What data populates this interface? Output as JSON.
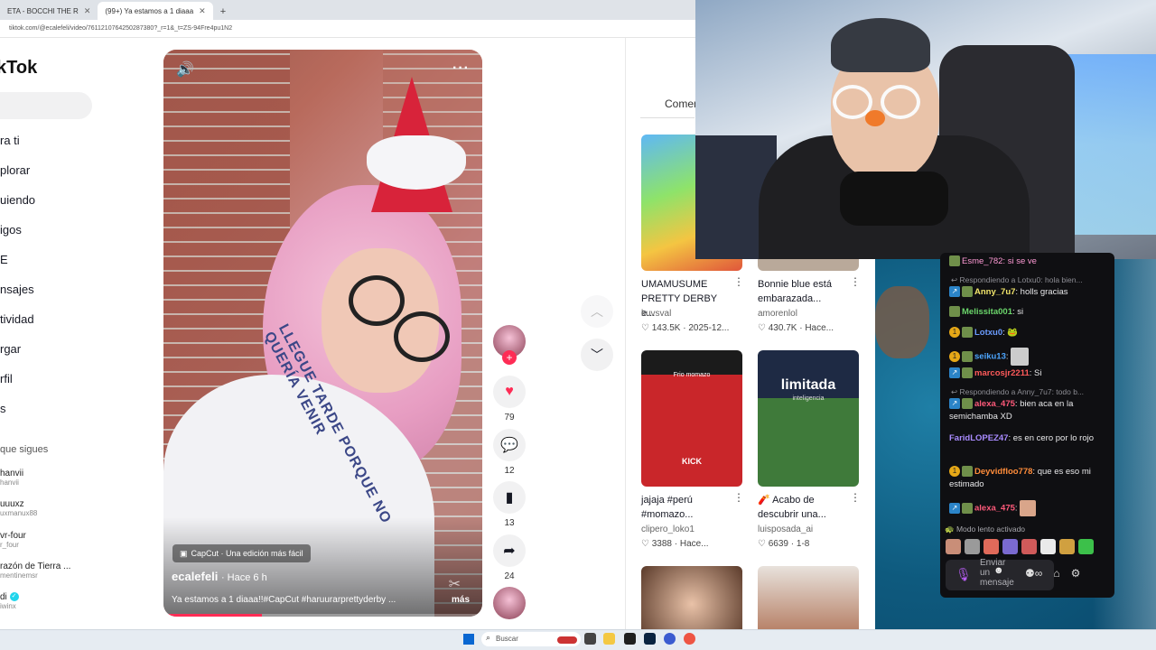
{
  "browser": {
    "tabs": [
      {
        "label": "ETA - BOCCHI THE R"
      },
      {
        "label": "(99+) Ya estamos a 1 diaaa"
      }
    ],
    "new_tab": "+",
    "address": "tiktok.com/@ecalefeli/video/7611210764250287380?_r=1&_t=ZS-94Fre4pu1N2"
  },
  "tiktok": {
    "logo": "kTok",
    "nav": [
      {
        "label": "ra ti"
      },
      {
        "label": "plorar"
      },
      {
        "label": "uiendo"
      },
      {
        "label": "igos"
      },
      {
        "label": "E"
      },
      {
        "label": "nsajes"
      },
      {
        "label": "tividad"
      },
      {
        "label": "rgar"
      },
      {
        "label": "rfil"
      },
      {
        "label": "s"
      }
    ],
    "following_header": "que sigues",
    "following": [
      {
        "name": "hanvii",
        "handle": "hanvii"
      },
      {
        "name": "uuuxz",
        "handle": "uxmanux88"
      },
      {
        "name": "vr-four",
        "handle": "r_four"
      },
      {
        "name": "razón de Tierra ...",
        "handle": "mentinemsr"
      },
      {
        "name": "di",
        "handle": "iwinx",
        "verified": true
      }
    ],
    "video": {
      "capcut_label": "CapCut · Una edición más fácil",
      "author": "ecalefeli",
      "time": "· Hace 6 h",
      "caption": "Ya estamos a 1 diaaa!!#CapCut #haruurarprettyderby ...",
      "more": "más",
      "shirt_text": "LLEGUE TARDE PORQUE NO QUERÍA VENIR",
      "progress": 0.31
    },
    "actions": {
      "likes": "79",
      "comments": "12",
      "saves": "13",
      "shares": "24"
    },
    "comments_tab": "Comen",
    "recommended": [
      {
        "title": "UMAMUSUME PRETTY DERBY e...",
        "author": "kuvsval",
        "stats": "♡ 143.5K · 2025-12..."
      },
      {
        "title": "Bonnie blue está embarazada...",
        "author": "amorenlol",
        "stats": "♡ 430.7K · Hace..."
      },
      {
        "title": "jajaja #perú #momazo...",
        "author": "clipero_loko1",
        "stats": "♡ 3388 · Hace...",
        "thumb_text": "Frio momazo",
        "thumb_tag": "KICK"
      },
      {
        "title": "🧨 Acabo de descubrir una...",
        "author": "luisposada_ai",
        "stats": "♡ 6639 · 1-8",
        "thumb_text": "limitada",
        "thumb_sub": "inteligencia"
      }
    ]
  },
  "chat": {
    "top_user": "Esme_782: si se ve",
    "messages": [
      {
        "type": "reply",
        "text": "↩ Respondiendo a Lotxu0: hola bien..."
      },
      {
        "type": "msg",
        "user": "Anny_7u7",
        "color": "#f3e66b",
        "text": ": holls gracias"
      },
      {
        "type": "msg",
        "user": "Melissita001",
        "color": "#6bd66b",
        "text": ": si"
      },
      {
        "type": "msg",
        "user": "Lotxu0",
        "color": "#6b9cff",
        "text": ":"
      },
      {
        "type": "msg",
        "user": "seiku13",
        "color": "#4da6ff",
        "text": ":"
      },
      {
        "type": "msg",
        "user": "marcosjr2211",
        "color": "#ff5a5a",
        "text": ": Si"
      },
      {
        "type": "reply",
        "text": "↩ Respondiendo a Anny_7u7: todo b..."
      },
      {
        "type": "msg",
        "user": "alexa_475",
        "color": "#ff5a7a",
        "text": ": bien aca en la semichamba XD"
      },
      {
        "type": "msg",
        "user": "FaridLOPEZ47",
        "color": "#a98bff",
        "text": ": es en cero por lo rojo"
      },
      {
        "type": "msg",
        "user": "Deyvidfloo778",
        "color": "#ff8c3a",
        "text": ": que es eso mi estimado"
      },
      {
        "type": "msg",
        "user": "alexa_475",
        "color": "#ff5a7a",
        "text": ":"
      }
    ],
    "slow_mode": "Modo lento activado",
    "input_placeholder": "Enviar un mensaje"
  },
  "taskbar": {
    "search": "Buscar"
  },
  "colors": {
    "tiktok_red": "#fe2c55",
    "chat_bg": "#0f0f12"
  }
}
